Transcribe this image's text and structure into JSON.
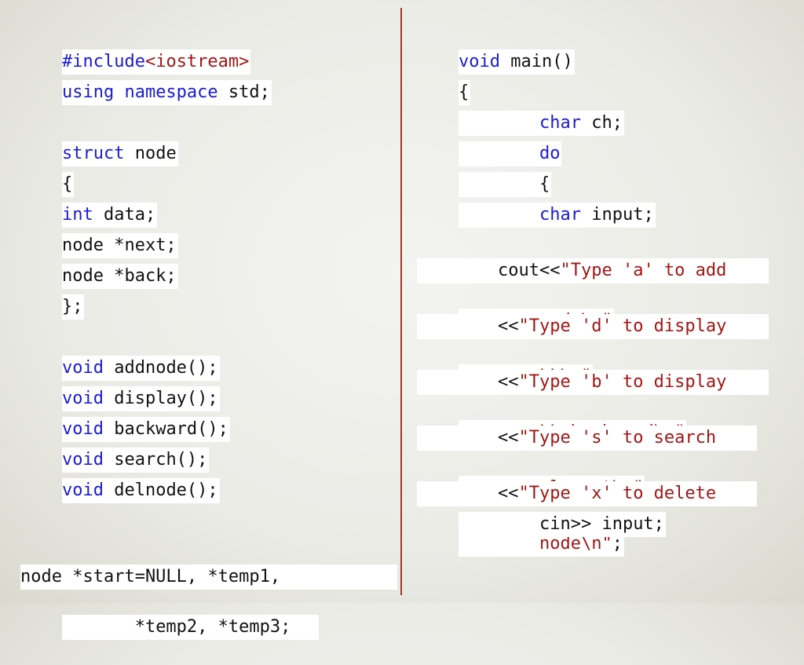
{
  "left_code": {
    "include": {
      "directive": "#include",
      "header": "<iostream>"
    },
    "using": {
      "kw": "using namespace",
      "rest": " std;"
    },
    "struct": {
      "kw": "struct",
      "rest": " node"
    },
    "open_brace": "{",
    "field_data": {
      "kw": "int",
      "rest": " data;"
    },
    "field_next": "node *next;",
    "field_back": "node *back;",
    "close_struct": "};",
    "decls": [
      {
        "kw": "void",
        "rest": " addnode();"
      },
      {
        "kw": "void",
        "rest": " display();"
      },
      {
        "kw": "void",
        "rest": " backward();"
      },
      {
        "kw": "void",
        "rest": " search();"
      },
      {
        "kw": "void",
        "rest": " delnode();"
      }
    ],
    "globals_line1": "node *start=NULL, *temp1,",
    "globals_line2": "       *temp2, *temp3;"
  },
  "right_code": {
    "main_sig": {
      "kw": "void",
      "rest": " main()"
    },
    "open_brace": "{",
    "char_ch": {
      "kw": "char",
      "rest": " ch;"
    },
    "do_kw": "do",
    "inner_brace": "{",
    "char_input": {
      "kw": "char",
      "rest": " input;"
    },
    "cout_prefix": "cout<<",
    "msg_a_1": "\"Type 'a' to add ",
    "msg_a_2": "node\\n\"",
    "op1": "<<",
    "msg_d_1": "\"Type 'd' to display ",
    "msg_d_2": "LL\\n\"",
    "op2": "<<",
    "msg_b_1": "\"Type 'b' to display ",
    "msg_b_2": "LL backward\\n\"",
    "op3": "<<",
    "msg_s_1": "\"Type 's' to search ",
    "msg_s_2": "element\\n\"",
    "op4": "<<",
    "msg_x_1": "\"Type 'x' to delete ",
    "msg_x_2": "node\\n\"",
    "semicolon": ";",
    "cin_line": "cin>> input;"
  },
  "colors": {
    "keyword": "#1a1ad6",
    "string": "#a31515",
    "text": "#111111",
    "divider": "#9a3b2c"
  }
}
